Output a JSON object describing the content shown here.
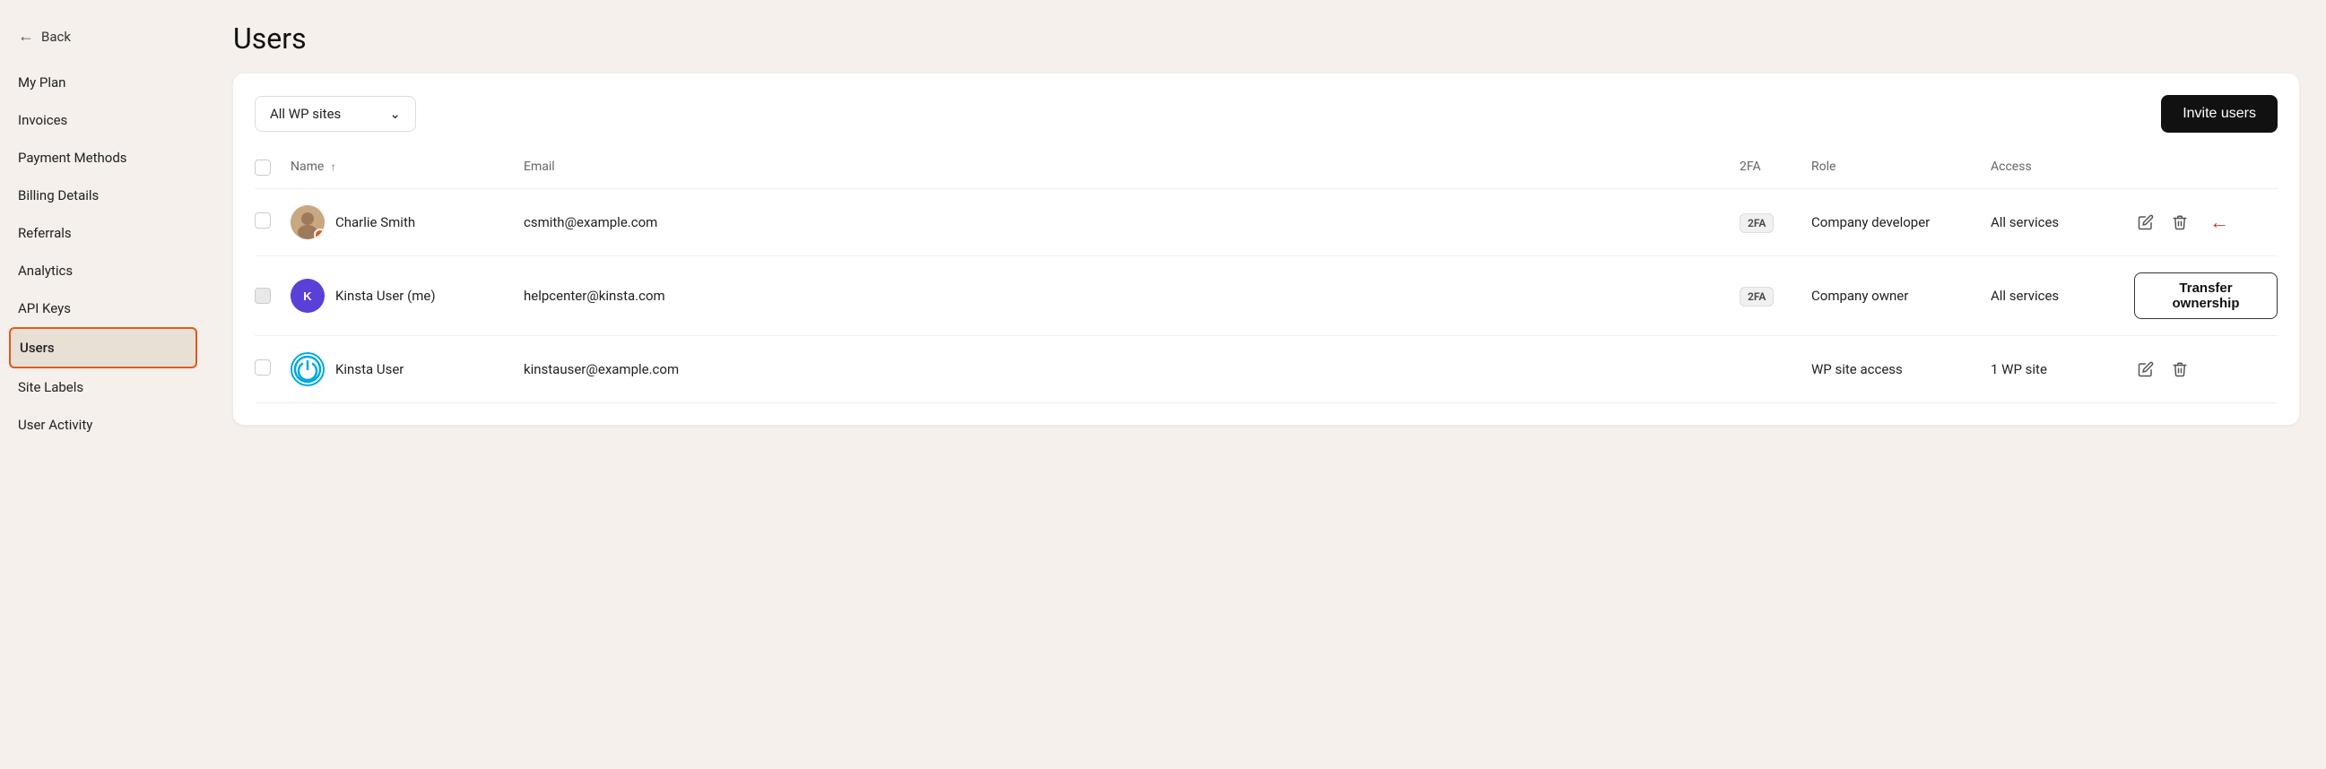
{
  "back_label": "Back",
  "page_title": "Users",
  "sidebar": {
    "items": [
      {
        "label": "My Plan",
        "id": "my-plan",
        "active": false
      },
      {
        "label": "Invoices",
        "id": "invoices",
        "active": false
      },
      {
        "label": "Payment Methods",
        "id": "payment-methods",
        "active": false
      },
      {
        "label": "Billing Details",
        "id": "billing-details",
        "active": false
      },
      {
        "label": "Referrals",
        "id": "referrals",
        "active": false
      },
      {
        "label": "Analytics",
        "id": "analytics",
        "active": false
      },
      {
        "label": "API Keys",
        "id": "api-keys",
        "active": false
      },
      {
        "label": "Users",
        "id": "users",
        "active": true
      },
      {
        "label": "Site Labels",
        "id": "site-labels",
        "active": false
      },
      {
        "label": "User Activity",
        "id": "user-activity",
        "active": false
      }
    ]
  },
  "filter_label": "All WP sites",
  "invite_button_label": "Invite users",
  "table": {
    "columns": {
      "name": "Name",
      "email": "Email",
      "twofa": "2FA",
      "role": "Role",
      "access": "Access"
    },
    "rows": [
      {
        "id": "charlie",
        "name": "Charlie Smith",
        "email": "csmith@example.com",
        "twofa": "2FA",
        "role": "Company developer",
        "access": "All services",
        "is_me": false,
        "has_edit": true,
        "has_delete": true,
        "has_transfer": false
      },
      {
        "id": "kinsta-me",
        "name": "Kinsta User (me)",
        "email": "helpcenter@kinsta.com",
        "twofa": "2FA",
        "role": "Company owner",
        "access": "All services",
        "is_me": true,
        "has_edit": false,
        "has_delete": false,
        "has_transfer": true,
        "transfer_label": "Transfer ownership"
      },
      {
        "id": "kinsta-user",
        "name": "Kinsta User",
        "email": "kinstauser@example.com",
        "twofa": "",
        "role": "WP site access",
        "access": "1 WP site",
        "is_me": false,
        "has_edit": true,
        "has_delete": true,
        "has_transfer": false
      }
    ]
  }
}
